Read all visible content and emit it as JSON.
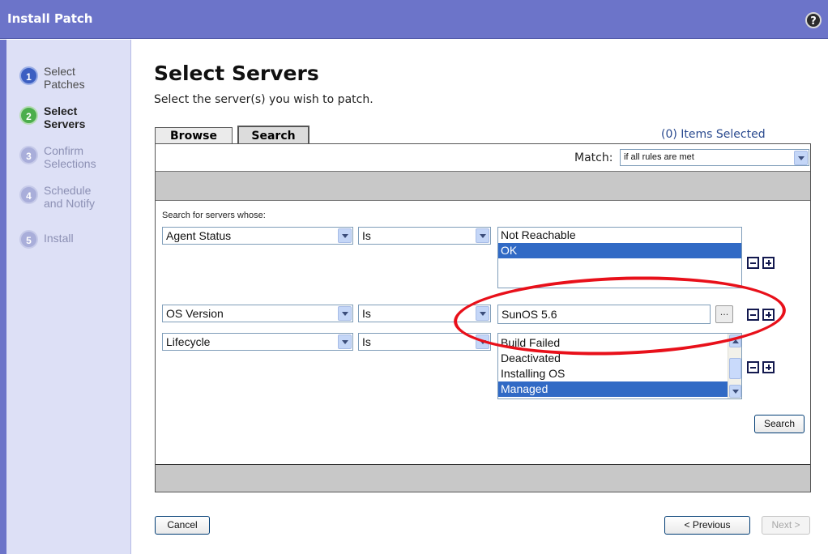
{
  "window": {
    "title": "Install Patch",
    "help_icon": "?"
  },
  "sidebar": {
    "steps": [
      {
        "number": "1",
        "label_line1": "Select",
        "label_line2": "Patches",
        "state": "done"
      },
      {
        "number": "2",
        "label_line1": "Select",
        "label_line2": "Servers",
        "state": "current"
      },
      {
        "number": "3",
        "label_line1": "Confirm",
        "label_line2": "Selections",
        "state": "todo"
      },
      {
        "number": "4",
        "label_line1": "Schedule",
        "label_line2": "and Notify",
        "state": "todo"
      },
      {
        "number": "5",
        "label_line1": "Install",
        "label_line2": "",
        "state": "todo"
      }
    ]
  },
  "main": {
    "title": "Select Servers",
    "subtitle": "Select the server(s) you wish to patch.",
    "tabs": [
      {
        "label": "Browse",
        "active": false
      },
      {
        "label": "Search",
        "active": true
      }
    ],
    "items_selected": "(0) Items Selected",
    "match": {
      "label": "Match:",
      "value": "if all rules are met"
    },
    "search_prompt": "Search for servers whose:",
    "rules": [
      {
        "attribute": "Agent Status",
        "operator": "Is",
        "value_type": "list",
        "options": [
          {
            "label": "Not Reachable",
            "selected": false
          },
          {
            "label": "OK",
            "selected": true
          }
        ]
      },
      {
        "attribute": "OS Version",
        "operator": "Is",
        "value_type": "text",
        "value": "SunOS 5.6",
        "browse_label": "..."
      },
      {
        "attribute": "Lifecycle",
        "operator": "Is",
        "value_type": "list",
        "options": [
          {
            "label": "Build Failed",
            "selected": false
          },
          {
            "label": "Deactivated",
            "selected": false
          },
          {
            "label": "Installing OS",
            "selected": false
          },
          {
            "label": "Managed",
            "selected": true
          }
        ]
      }
    ],
    "search_button": "Search"
  },
  "footer": {
    "cancel": "Cancel",
    "previous": "< Previous",
    "next": "Next >"
  },
  "colors": {
    "title_bar": "#6c74c9",
    "sidebar_bg": "#dde0f6",
    "selected_option": "#316ac5",
    "annotation_oval": "#e8101a"
  }
}
